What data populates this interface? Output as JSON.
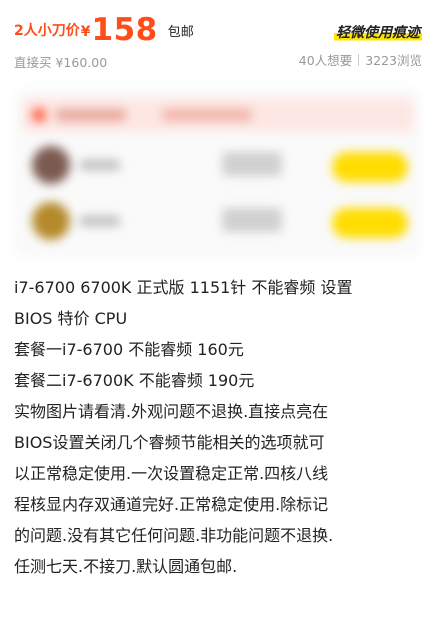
{
  "price": {
    "deal_label": "2人小刀价",
    "currency": "¥",
    "amount": "158",
    "shipping": "包邮"
  },
  "condition_tag": "轻微使用痕迹",
  "direct_buy": "直接买 ¥160.00",
  "stats": {
    "wants": "40人想要",
    "views": "3223浏览"
  },
  "colors": {
    "accent": "#ff4d1a",
    "highlight": "#ffe600",
    "join_button": "#ffdd00"
  },
  "description": [
    "i7-6700 6700K 正式版 1151针 不能睿频 设置",
    "BIOS 特价 CPU",
    "套餐一i7-6700 不能睿频 160元",
    "套餐二i7-6700K 不能睿频 190元",
    "实物图片请看清.外观问题不退换.直接点亮在",
    "BIOS设置关闭几个睿频节能相关的选项就可",
    "以正常稳定使用.一次设置稳定正常.四核八线",
    "程核显内存双通道完好.正常稳定使用.除标记",
    "的问题.没有其它任何问题.非功能问题不退换.",
    "任测七天.不接刀.默认圆通包邮."
  ]
}
